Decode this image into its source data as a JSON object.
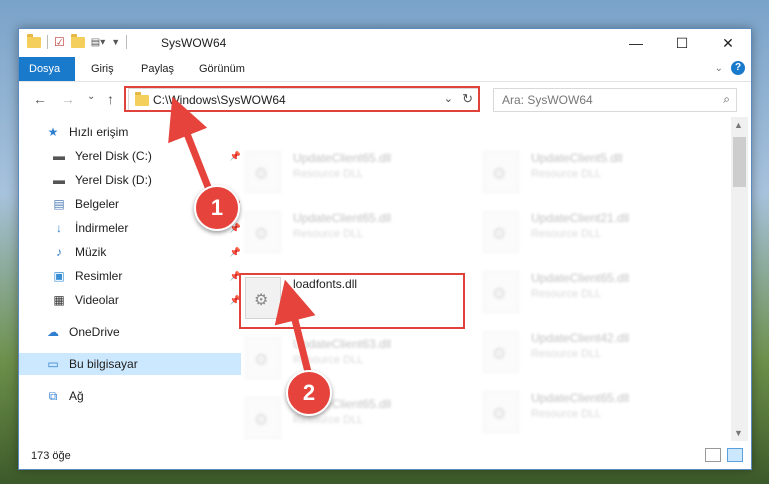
{
  "window": {
    "title": "SysWOW64"
  },
  "window_controls": {
    "minimize": "—",
    "maximize": "☐",
    "close": "✕"
  },
  "ribbon": {
    "tabs": [
      "Dosya",
      "Giriş",
      "Paylaş",
      "Görünüm"
    ],
    "active_tab": "Dosya",
    "help": "?"
  },
  "address": {
    "path": "C:\\Windows\\SysWOW64",
    "dropdown": "⌄",
    "refresh": "↻"
  },
  "search": {
    "placeholder": "Ara: SysWOW64"
  },
  "nav_buttons": {
    "back": "←",
    "forward": "→",
    "recent": "⌄",
    "up": "↑"
  },
  "sidebar": {
    "items": [
      {
        "label": "Hızlı erişim",
        "icon": "star-icon"
      },
      {
        "label": "Yerel Disk (C:)",
        "icon": "drive-icon"
      },
      {
        "label": "Yerel Disk (D:)",
        "icon": "drive-icon"
      },
      {
        "label": "Belgeler",
        "icon": "documents-icon"
      },
      {
        "label": "İndirmeler",
        "icon": "download-icon"
      },
      {
        "label": "Müzik",
        "icon": "music-icon"
      },
      {
        "label": "Resimler",
        "icon": "pictures-icon"
      },
      {
        "label": "Videolar",
        "icon": "videos-icon"
      },
      {
        "label": "OneDrive",
        "icon": "cloud-icon"
      },
      {
        "label": "Bu bilgisayar",
        "icon": "computer-icon"
      },
      {
        "label": "Ağ",
        "icon": "network-icon"
      }
    ],
    "selected": "Bu bilgisayar"
  },
  "files": {
    "left": [
      {
        "name": "UpdateClient65.dll",
        "type": "Resource DLL"
      },
      {
        "name": "UpdateClient65.dll",
        "type": "Resource DLL"
      },
      {
        "name": "loadfonts.dll",
        "type": ""
      },
      {
        "name": "UpdateClient63.dll",
        "type": "Resource DLL"
      },
      {
        "name": "UpdateClient65.dll",
        "type": "Resource DLL"
      }
    ],
    "right": [
      {
        "name": "UpdateClient5.dll",
        "type": "Resource DLL"
      },
      {
        "name": "UpdateClient21.dll",
        "type": "Resource DLL"
      },
      {
        "name": "UpdateClient65.dll",
        "type": "Resource DLL"
      },
      {
        "name": "UpdateClient42.dll",
        "type": "Resource DLL"
      },
      {
        "name": "UpdateClient65.dll",
        "type": "Resource DLL"
      }
    ],
    "highlighted": "loadfonts.dll"
  },
  "status": {
    "item_count": "173 öğe"
  },
  "callouts": {
    "first": "1",
    "second": "2"
  },
  "colors": {
    "accent": "#1979ca",
    "callout": "#e5433b",
    "highlight_border": "#e0423b",
    "selected": "#cce8ff"
  }
}
